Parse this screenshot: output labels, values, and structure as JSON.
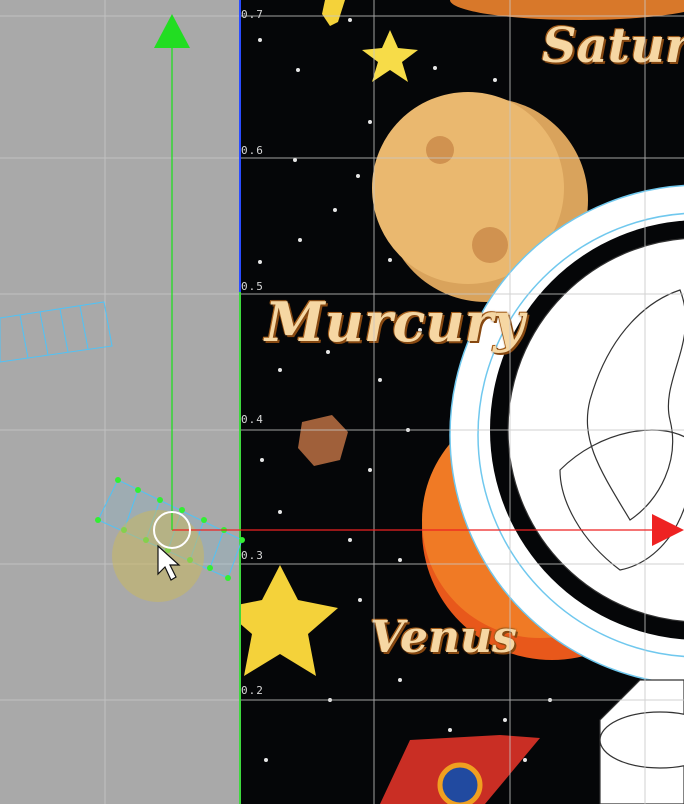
{
  "viewport": {
    "v_axis_labels": [
      "0.7",
      "0.6",
      "0.5",
      "0.4",
      "0.3",
      "0.2"
    ],
    "planet_labels": {
      "saturn": "Saturn",
      "mercury": "Murcury",
      "venus": "Venus"
    }
  },
  "colors": {
    "outside_background": "#a9a9a9",
    "texture_background": "#050608",
    "grid_line": "#c8c8c8",
    "y_axis_gizmo": "#22dd22",
    "x_axis_gizmo": "#ee2222",
    "selection_outline": "#4fc3f7",
    "selected_vertex": "#33ee33",
    "pivot_highlight": "#c8b860"
  },
  "icons": [
    "y-axis-arrow-icon",
    "x-axis-arrow-icon",
    "mouse-cursor-icon",
    "pivot-circle-icon"
  ]
}
